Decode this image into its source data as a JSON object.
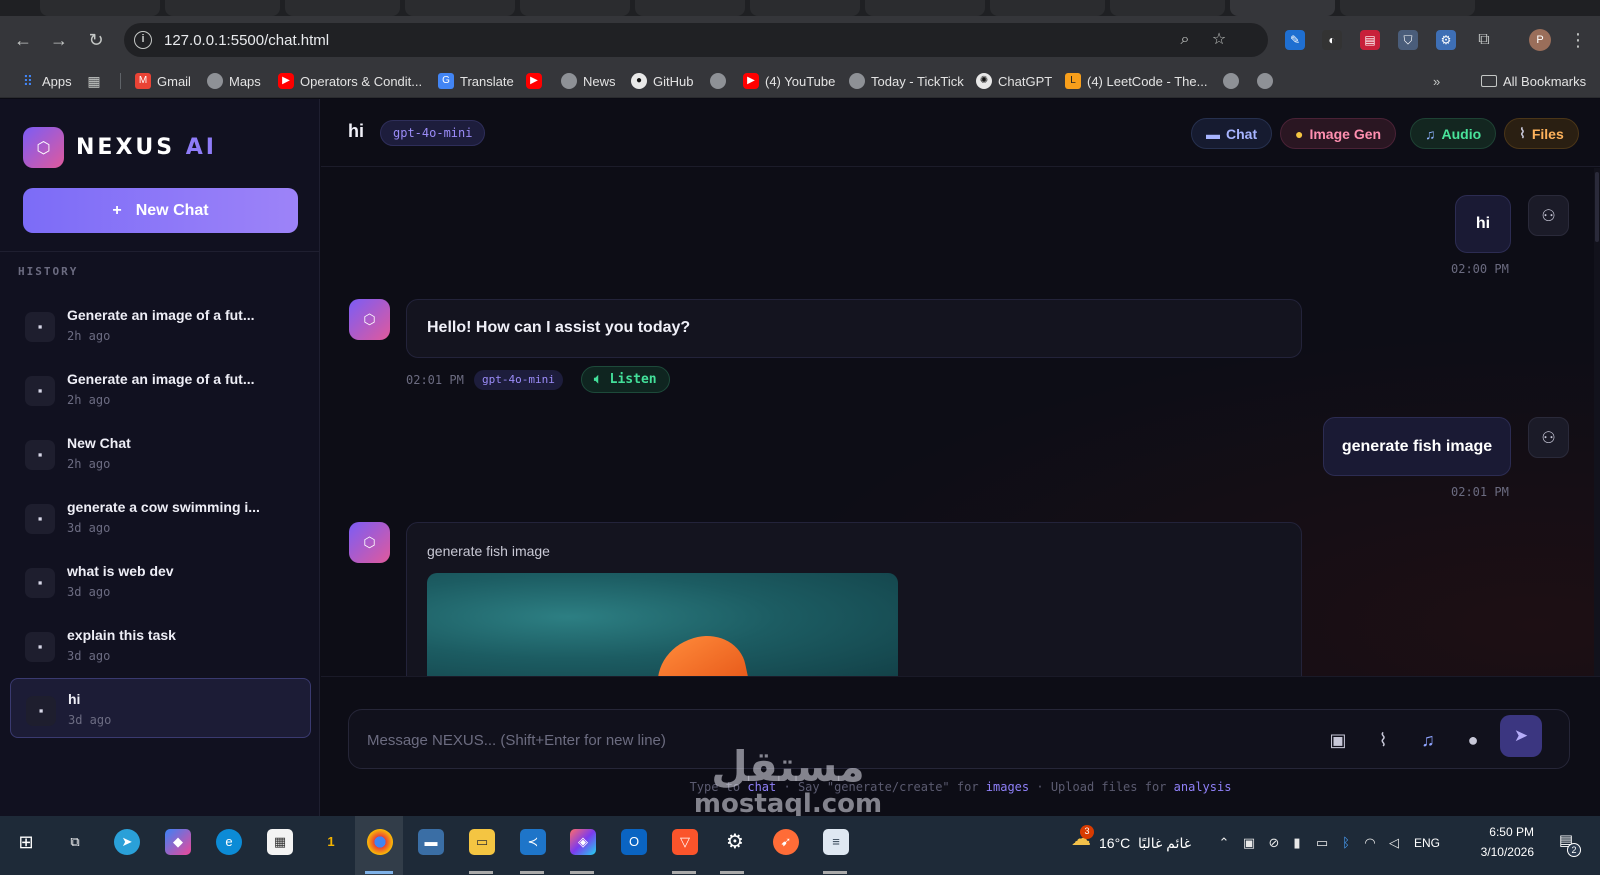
{
  "browser": {
    "url": "127.0.0.1:5500/chat.html",
    "profile_initial": "P",
    "bookmarks": [
      {
        "label": "Apps",
        "icon": "apps-grid-icon"
      },
      {
        "label": "Gmail",
        "icon": "gmail-icon"
      },
      {
        "label": "Maps",
        "icon": "globe-icon"
      },
      {
        "label": "Operators & Condit...",
        "icon": "youtube-icon"
      },
      {
        "label": "Translate",
        "icon": "translate-icon"
      },
      {
        "label": "News",
        "icon": "globe-icon"
      },
      {
        "label": "GitHub",
        "icon": "github-icon"
      },
      {
        "label": "(4) YouTube",
        "icon": "youtube-icon"
      },
      {
        "label": "Today - TickTick",
        "icon": "globe-icon"
      },
      {
        "label": "ChatGPT",
        "icon": "chatgpt-icon"
      },
      {
        "label": "(4) LeetCode - The...",
        "icon": "leetcode-icon"
      }
    ],
    "all_bookmarks_label": "All Bookmarks"
  },
  "sidebar": {
    "logo": {
      "brand": "NEXUS",
      "suffix": " AI",
      "icon": "hexagon-icon"
    },
    "new_chat_plus": "+",
    "new_chat_label": "New Chat",
    "history_label": "HISTORY",
    "history": [
      {
        "title": "Generate an image of a fut...",
        "time": "2h ago"
      },
      {
        "title": "Generate an image of a fut...",
        "time": "2h ago"
      },
      {
        "title": "New Chat",
        "time": "2h ago"
      },
      {
        "title": "generate a cow swimming i...",
        "time": "3d ago"
      },
      {
        "title": "what is web dev",
        "time": "3d ago"
      },
      {
        "title": "explain this task",
        "time": "3d ago"
      },
      {
        "title": "hi",
        "time": "3d ago",
        "active": true
      }
    ]
  },
  "header": {
    "title": "hi",
    "model": "gpt-4o-mini",
    "modes": [
      {
        "label": "Chat",
        "icon": "chat-icon",
        "color": "#a7b4ff"
      },
      {
        "label": "Image Gen",
        "icon": "palette-icon",
        "color": "#ff8fb0"
      },
      {
        "label": "Audio",
        "icon": "music-note-icon",
        "color": "#49e39a"
      },
      {
        "label": "Files",
        "icon": "paperclip-icon",
        "color": "#ffb35c"
      }
    ]
  },
  "messages": [
    {
      "role": "user",
      "text": "hi",
      "time": "02:00 PM"
    },
    {
      "role": "assistant",
      "text": "Hello! How can I assist you today?",
      "time": "02:01 PM",
      "model": "gpt-4o-mini",
      "listen_label": "Listen"
    },
    {
      "role": "user",
      "text": "generate fish image",
      "time": "02:01 PM"
    },
    {
      "role": "assistant",
      "text": "generate fish image",
      "has_image": true
    }
  ],
  "composer": {
    "placeholder": "Message NEXUS... (Shift+Enter for new line)",
    "hint": {
      "p1": "Type to ",
      "chat": "chat",
      "p2": " · Say \"generate/create\" for ",
      "images": "images",
      "p3": " · Upload files for ",
      "analysis": "analysis"
    }
  },
  "watermark": {
    "arabic": "مستقل",
    "latin": "mostaql.com"
  },
  "taskbar": {
    "weather_temp": "16°C",
    "weather_desc": "غائم غالبًا",
    "language": "ENG",
    "time": "6:50 PM",
    "date": "3/10/2026",
    "notifications": "2",
    "weather_badge": "3"
  },
  "colors": {
    "accent": "#8f7cf8",
    "brand_gradient_start": "#7b5cf5",
    "brand_gradient_end": "#e05a9c",
    "listen_green": "#43e09a"
  }
}
